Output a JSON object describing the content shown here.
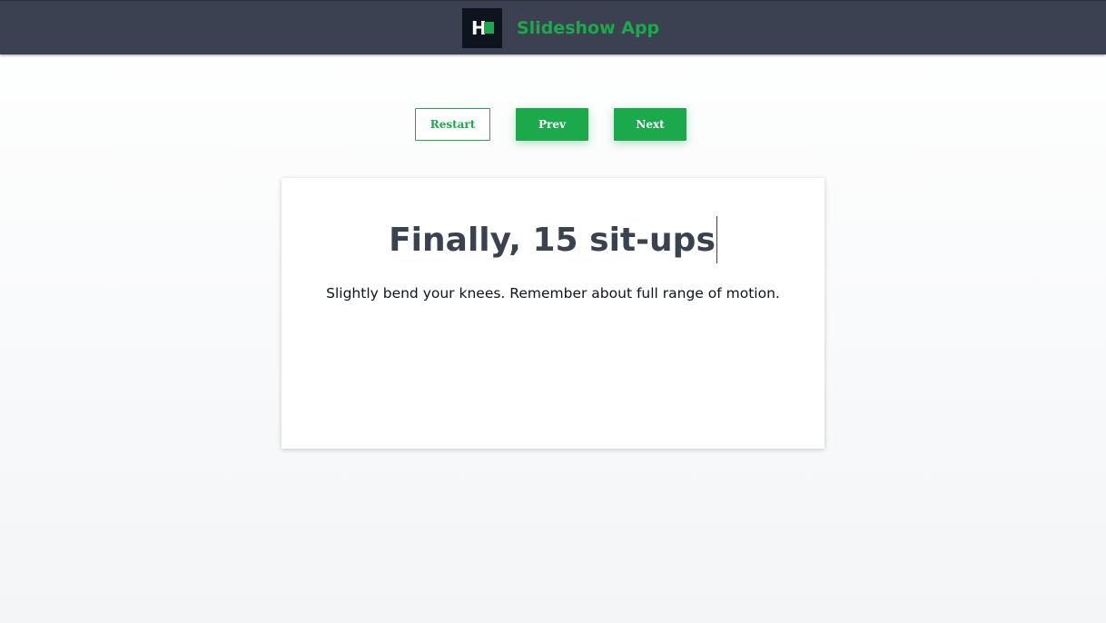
{
  "header": {
    "logo_letter": "H",
    "app_title": "Slideshow App"
  },
  "controls": {
    "restart_label": "Restart",
    "prev_label": "Prev",
    "next_label": "Next"
  },
  "slide": {
    "title": "Finally, 15 sit-ups",
    "text": "Slightly bend your knees. Remember about full range of motion."
  },
  "colors": {
    "header_bg": "#3b4150",
    "brand_green": "#1ba94c",
    "text_dark": "#39424e",
    "logo_bg": "#0e141e"
  },
  "icons": {
    "logo": "hackerrank-logo-icon"
  }
}
